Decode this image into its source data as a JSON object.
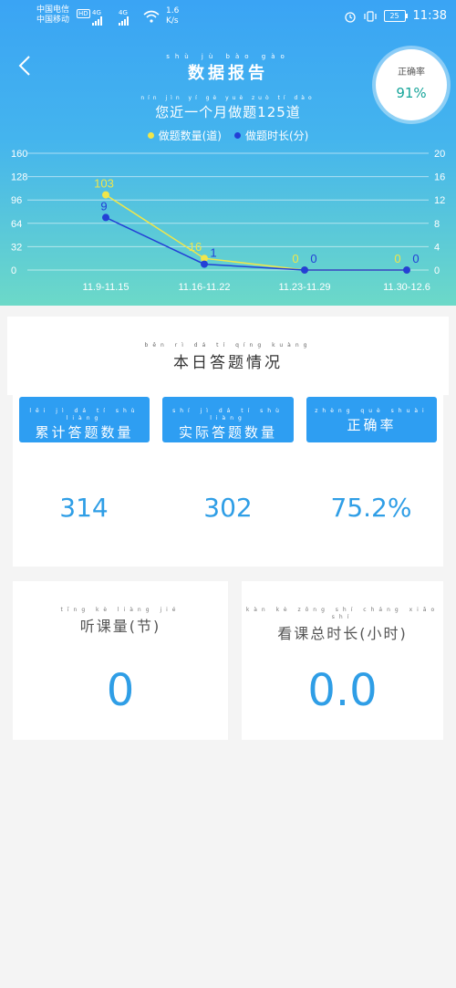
{
  "status_bar": {
    "carrier_line1": "中国电信",
    "carrier_line2": "中国移动",
    "net1": "4G",
    "net2": "4G",
    "hd": "HD",
    "speed_value": "1.6",
    "speed_unit": "K/s",
    "battery": "25",
    "time": "11:38"
  },
  "header": {
    "title_pinyin": "shù jù bào gào",
    "title": "数据报告",
    "subtitle_pinyin": "nín jìn yí gè yuè zuò tí dào",
    "subtitle": "您近一个月做题125道",
    "legend": [
      {
        "pinyin": "zuò tí shù liàng dào",
        "label": "做题数量(道)",
        "color": "#f0e64a"
      },
      {
        "pinyin": "zuò tí shí cháng fēn",
        "label": "做题时长(分)",
        "color": "#2340d6"
      }
    ]
  },
  "accuracy": {
    "pinyin": "zhèng què lǜ",
    "label": "正确率",
    "value": "91%"
  },
  "chart_data": {
    "type": "line",
    "categories": [
      "11.9-11.15",
      "11.16-11.22",
      "11.23-11.29",
      "11.30-12.6"
    ],
    "left_ticks": [
      "160",
      "128",
      "96",
      "64",
      "32",
      "0"
    ],
    "right_ticks": [
      "20",
      "16",
      "12",
      "8",
      "4",
      "0"
    ],
    "ylim_left": [
      0,
      160
    ],
    "ylim_right": [
      0,
      20
    ],
    "series": [
      {
        "name": "做题数量(道)",
        "axis": "left",
        "color": "#f0e64a",
        "values": [
          103,
          16,
          0,
          0
        ],
        "labels": [
          "103",
          "16",
          "0",
          "0"
        ]
      },
      {
        "name": "做题时长(分)",
        "axis": "right",
        "color": "#2340d6",
        "values": [
          9,
          1,
          0,
          0
        ],
        "labels": [
          "9",
          "1",
          "0",
          "0"
        ]
      }
    ],
    "grid": true
  },
  "today": {
    "pinyin": "běn rì dá tí qíng kuàng",
    "title": "本日答题情况",
    "stats": [
      {
        "pinyin": "lěi jì dá tí shù liàng",
        "label": "累计答题数量",
        "value": "314"
      },
      {
        "pinyin": "shí jì dá tí shù liàng",
        "label": "实际答题数量",
        "value": "302"
      },
      {
        "pinyin": "zhèng què shuài",
        "label": "正确率",
        "value": "75.2%"
      }
    ]
  },
  "listen": {
    "pinyin": "tīng kè liàng jié",
    "title": "听课量(节)",
    "value": "0"
  },
  "watch": {
    "pinyin": "kàn kè zǒng shí cháng xiǎo shí",
    "title": "看课总时长(小时)",
    "value": "0.0"
  }
}
